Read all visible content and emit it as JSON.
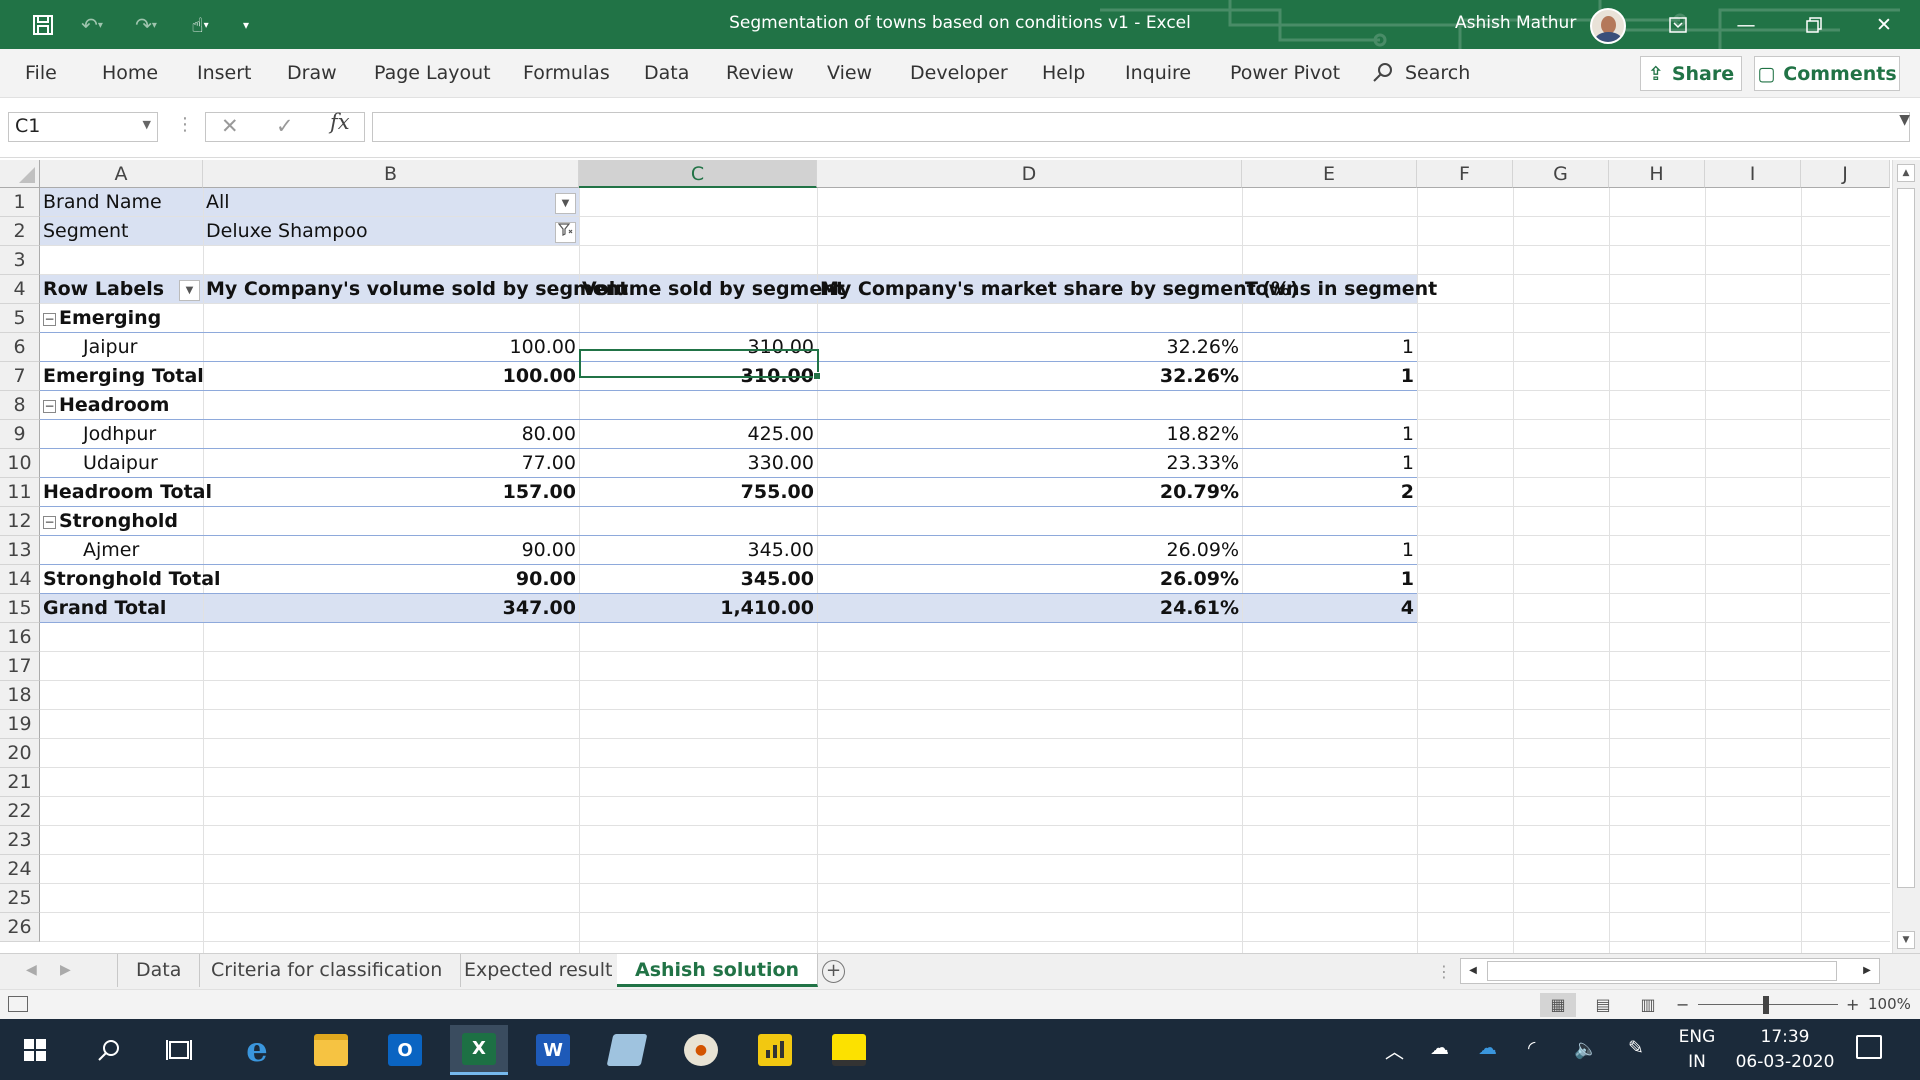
{
  "window": {
    "doc_title": "Segmentation of towns based on conditions v1",
    "app_name": "Excel",
    "user_name": "Ashish Mathur"
  },
  "ribbon": {
    "tabs": [
      "File",
      "Home",
      "Insert",
      "Draw",
      "Page Layout",
      "Formulas",
      "Data",
      "Review",
      "View",
      "Developer",
      "Help",
      "Inquire",
      "Power Pivot"
    ],
    "search_label": "Search",
    "share_label": "Share",
    "comments_label": "Comments"
  },
  "formula_bar": {
    "name_box": "C1",
    "formula": ""
  },
  "grid": {
    "columns": [
      "A",
      "B",
      "C",
      "D",
      "E",
      "F",
      "G",
      "H",
      "I",
      "J"
    ],
    "rows": [
      "1",
      "2",
      "3",
      "4",
      "5",
      "6",
      "7",
      "8",
      "9",
      "10",
      "11",
      "12",
      "13",
      "14",
      "15",
      "16",
      "17",
      "18",
      "19",
      "20",
      "21",
      "22",
      "23",
      "24",
      "25",
      "26"
    ],
    "selected_column": "C"
  },
  "filters": [
    {
      "label": "Brand Name",
      "value": "All"
    },
    {
      "label": "Segment",
      "value": "Deluxe Shampoo"
    }
  ],
  "pivot": {
    "headers": [
      "Row Labels",
      "My Company's volume sold by segment",
      "Volume sold by segment",
      "My Company's market share by segment (%)",
      "Towns in segment"
    ],
    "rows": [
      {
        "type": "group",
        "label": "Emerging"
      },
      {
        "type": "item",
        "label": "Jaipur",
        "v1": "100.00",
        "v2": "310.00",
        "share": "32.26%",
        "towns": "1"
      },
      {
        "type": "total",
        "label": "Emerging Total",
        "v1": "100.00",
        "v2": "310.00",
        "share": "32.26%",
        "towns": "1"
      },
      {
        "type": "group",
        "label": "Headroom"
      },
      {
        "type": "item",
        "label": "Jodhpur",
        "v1": "80.00",
        "v2": "425.00",
        "share": "18.82%",
        "towns": "1"
      },
      {
        "type": "item",
        "label": "Udaipur",
        "v1": "77.00",
        "v2": "330.00",
        "share": "23.33%",
        "towns": "1"
      },
      {
        "type": "total",
        "label": "Headroom Total",
        "v1": "157.00",
        "v2": "755.00",
        "share": "20.79%",
        "towns": "2"
      },
      {
        "type": "group",
        "label": "Stronghold"
      },
      {
        "type": "item",
        "label": "Ajmer",
        "v1": "90.00",
        "v2": "345.00",
        "share": "26.09%",
        "towns": "1"
      },
      {
        "type": "total",
        "label": "Stronghold Total",
        "v1": "90.00",
        "v2": "345.00",
        "share": "26.09%",
        "towns": "1"
      },
      {
        "type": "grand",
        "label": "Grand Total",
        "v1": "347.00",
        "v2": "1,410.00",
        "share": "24.61%",
        "towns": "4"
      }
    ]
  },
  "sheets": {
    "tabs": [
      "Data",
      "Criteria for classification",
      "Expected result",
      "Ashish solution"
    ],
    "active": "Ashish solution"
  },
  "status": {
    "zoom": "100%"
  },
  "taskbar": {
    "lang_top": "ENG",
    "lang_bottom": "IN",
    "time": "17:39",
    "date": "06-03-2020"
  }
}
